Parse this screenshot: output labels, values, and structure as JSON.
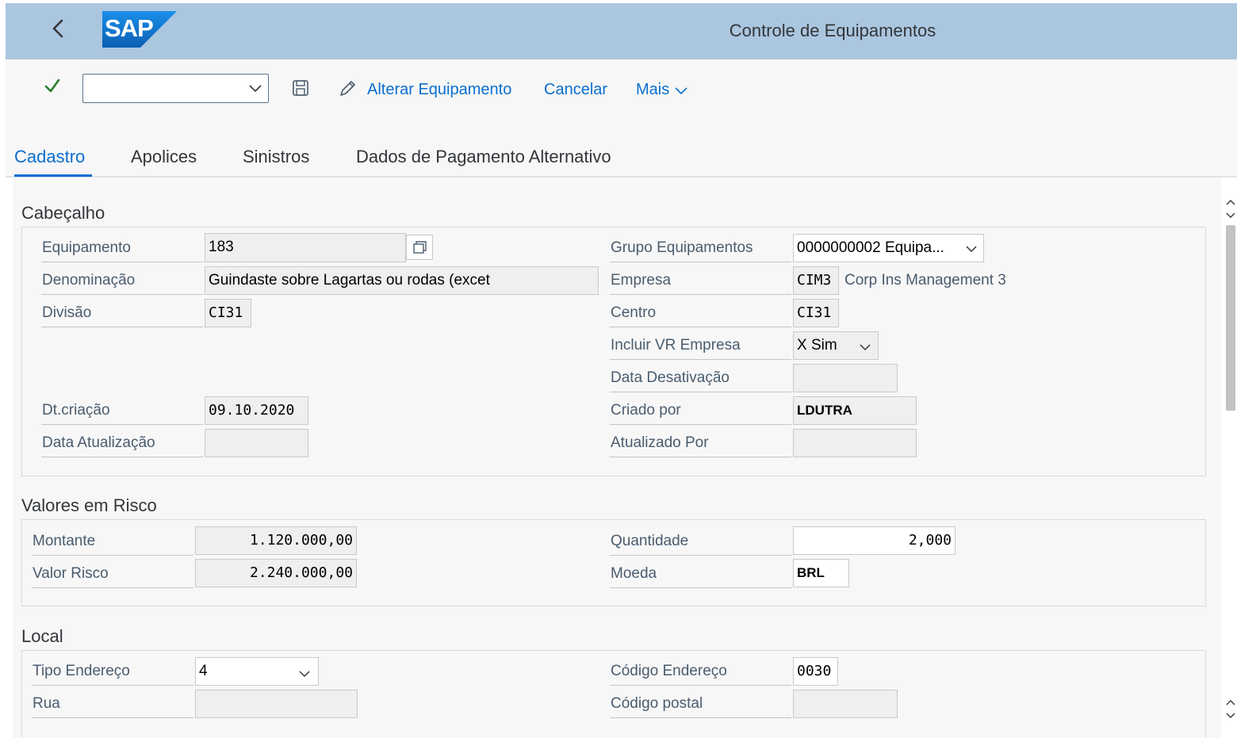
{
  "shell": {
    "title": "Controle de Equipamentos",
    "logo_text": "SAP",
    "back_icon": "chevron-left-icon"
  },
  "toolbar": {
    "command_field_value": "",
    "alterar_label": "Alterar Equipamento",
    "cancelar_label": "Cancelar",
    "mais_label": "Mais"
  },
  "tabs": [
    {
      "label": "Cadastro",
      "active": true
    },
    {
      "label": "Apolices"
    },
    {
      "label": "Sinistros"
    },
    {
      "label": "Dados de Pagamento Alternativo"
    }
  ],
  "cabecalho": {
    "title": "Cabeçalho",
    "equipamento": {
      "label": "Equipamento",
      "value": "183"
    },
    "denominacao": {
      "label": "Denominação",
      "value": "Guindaste sobre Lagartas ou rodas (excet"
    },
    "divisao": {
      "label": "Divisão",
      "value": "CI31"
    },
    "dt_criacao": {
      "label": "Dt.criação",
      "value": "09.10.2020"
    },
    "data_atualizacao": {
      "label": "Data Atualização",
      "value": ""
    },
    "grupo_equipamentos": {
      "label": "Grupo Equipamentos",
      "value": "0000000002 Equipa..."
    },
    "empresa": {
      "label": "Empresa",
      "value": "CIM3",
      "description": "Corp Ins Management 3"
    },
    "centro": {
      "label": "Centro",
      "value": "CI31"
    },
    "incluir_vr_empresa": {
      "label": "Incluir VR Empresa",
      "value": "X Sim"
    },
    "data_desativacao": {
      "label": "Data Desativação",
      "value": ""
    },
    "criado_por": {
      "label": "Criado por",
      "value": "LDUTRA"
    },
    "atualizado_por": {
      "label": "Atualizado Por",
      "value": ""
    }
  },
  "valores": {
    "title": "Valores em Risco",
    "montante": {
      "label": "Montante",
      "value": "1.120.000,00"
    },
    "valor_risco": {
      "label": "Valor Risco",
      "value": "2.240.000,00"
    },
    "quantidade": {
      "label": "Quantidade",
      "value": "2,000"
    },
    "moeda": {
      "label": "Moeda",
      "value": "BRL"
    }
  },
  "local": {
    "title": "Local",
    "tipo_endereco": {
      "label": "Tipo Endereço",
      "value": "4"
    },
    "rua": {
      "label": "Rua",
      "value": ""
    },
    "codigo_endereco": {
      "label": "Código Endereço",
      "value": "0030"
    },
    "codigo_postal": {
      "label": "Código postal",
      "value": ""
    }
  },
  "colors": {
    "shell_bg": "#abc6df",
    "accent": "#0a6ed1",
    "check": "#2b7d2b",
    "logo_bg": "#0a74d0"
  }
}
